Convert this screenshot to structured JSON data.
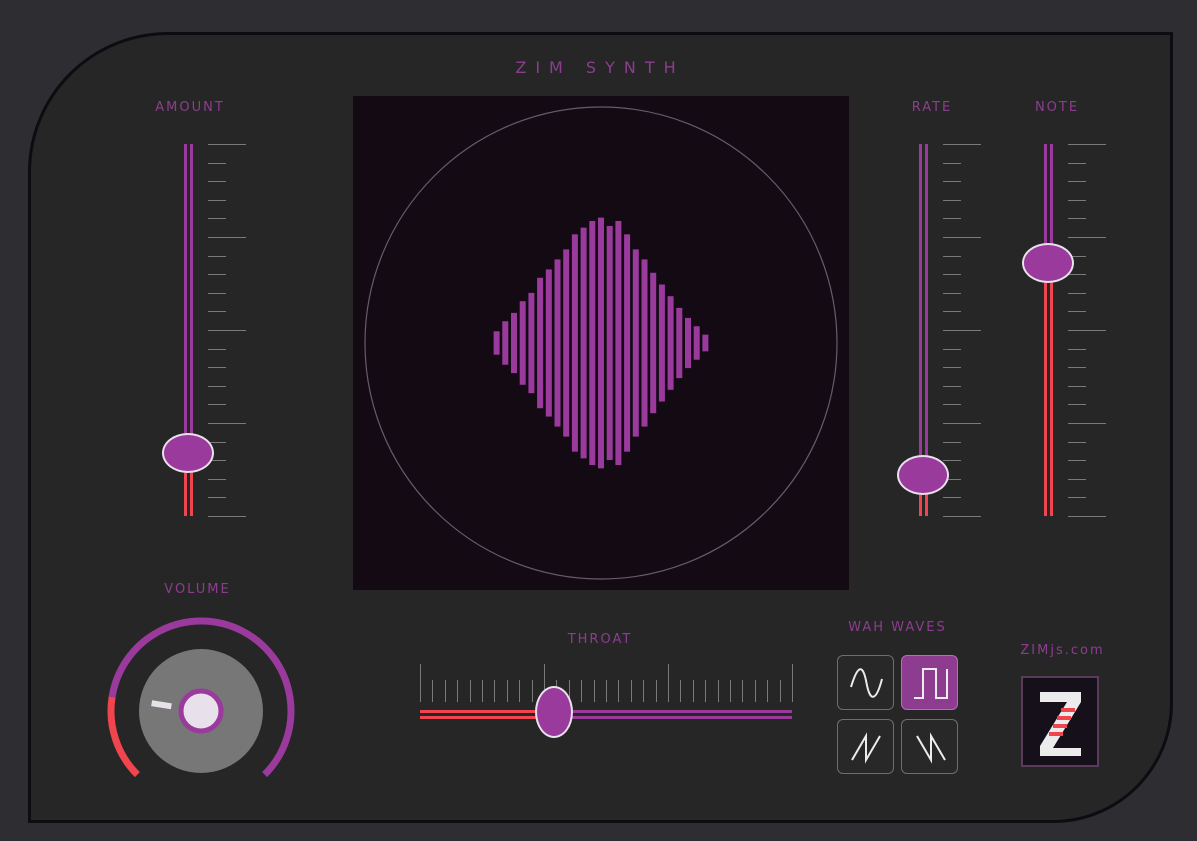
{
  "title": "ZIM SYNTH",
  "sliders": {
    "amount": {
      "label": "AMOUNT",
      "value": 0.17
    },
    "rate": {
      "label": "RATE",
      "value": 0.11
    },
    "note": {
      "label": "NOTE",
      "value": 0.68
    },
    "throat": {
      "label": "THROAT",
      "value": 0.36
    }
  },
  "volume": {
    "label": "VOLUME",
    "value": 0.2
  },
  "wah_waves": {
    "label": "WAH WAVES",
    "options": [
      "sine",
      "square",
      "sawtooth",
      "reverse-sawtooth"
    ],
    "selected": "square"
  },
  "brand": {
    "label": "ZIMjs.com",
    "logo_text": "Z"
  },
  "visualizer_bars": [
    0.14,
    0.26,
    0.36,
    0.5,
    0.6,
    0.78,
    0.88,
    1.0,
    1.12,
    1.3,
    1.38,
    1.46,
    1.5,
    1.4,
    1.46,
    1.3,
    1.12,
    1.0,
    0.84,
    0.7,
    0.56,
    0.42,
    0.3,
    0.2,
    0.1
  ],
  "colors": {
    "accent_purple": "#9a3a9d",
    "accent_red": "#f0454e",
    "panel": "#262626",
    "screen": "#130a14"
  }
}
